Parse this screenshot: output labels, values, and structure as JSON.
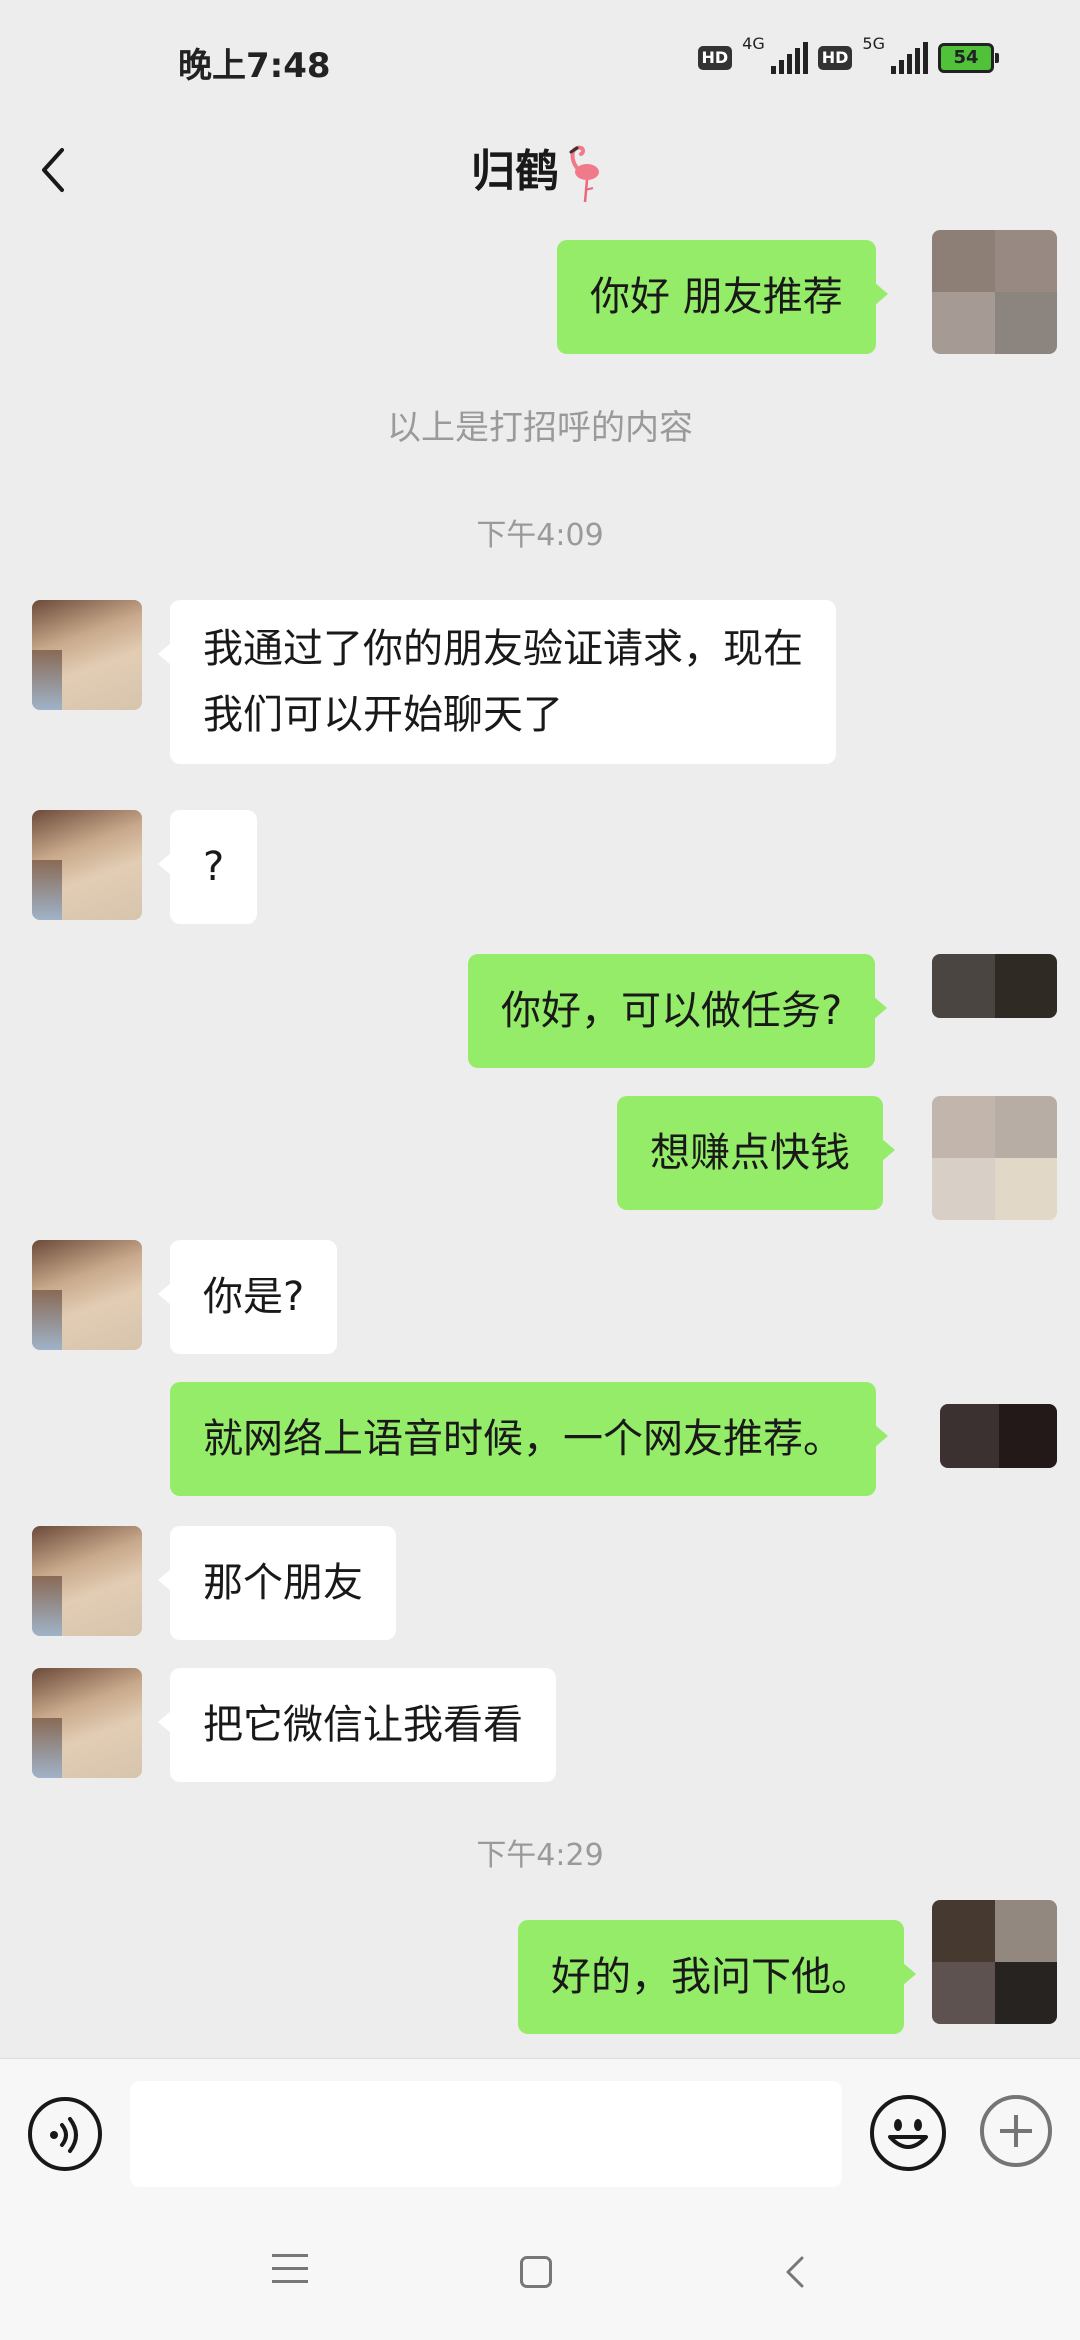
{
  "status_bar": {
    "time": "晚上7:48",
    "hd_label": "HD",
    "net1": "4G",
    "net2": "5G",
    "battery": "54"
  },
  "header": {
    "title": "归鹤"
  },
  "messages": {
    "m1": "你好 朋友推荐",
    "greeting_note": "以上是打招呼的内容",
    "time1": "下午4:09",
    "m2_line1": "我通过了你的朋友验证请求，现在",
    "m2_line2": "我们可以开始聊天了",
    "m3": "?",
    "m4": "你好，可以做任务?",
    "m5": "想赚点快钱",
    "m6": "你是?",
    "m7": "就网络上语音时候，一个网友推荐。",
    "m8": "那个朋友",
    "m9": "把它微信让我看看",
    "time2": "下午4:29",
    "m10": "好的，我问下他。"
  },
  "input_bar": {
    "value": "",
    "placeholder": ""
  },
  "colors": {
    "my_bubble": "#95ec69",
    "other_bubble": "#ffffff",
    "background": "#ededed"
  },
  "icons": {
    "back": "back-arrow-icon",
    "voice": "voice-icon",
    "emoji": "emoji-icon",
    "plus": "plus-icon",
    "flamingo": "flamingo-emoji"
  }
}
